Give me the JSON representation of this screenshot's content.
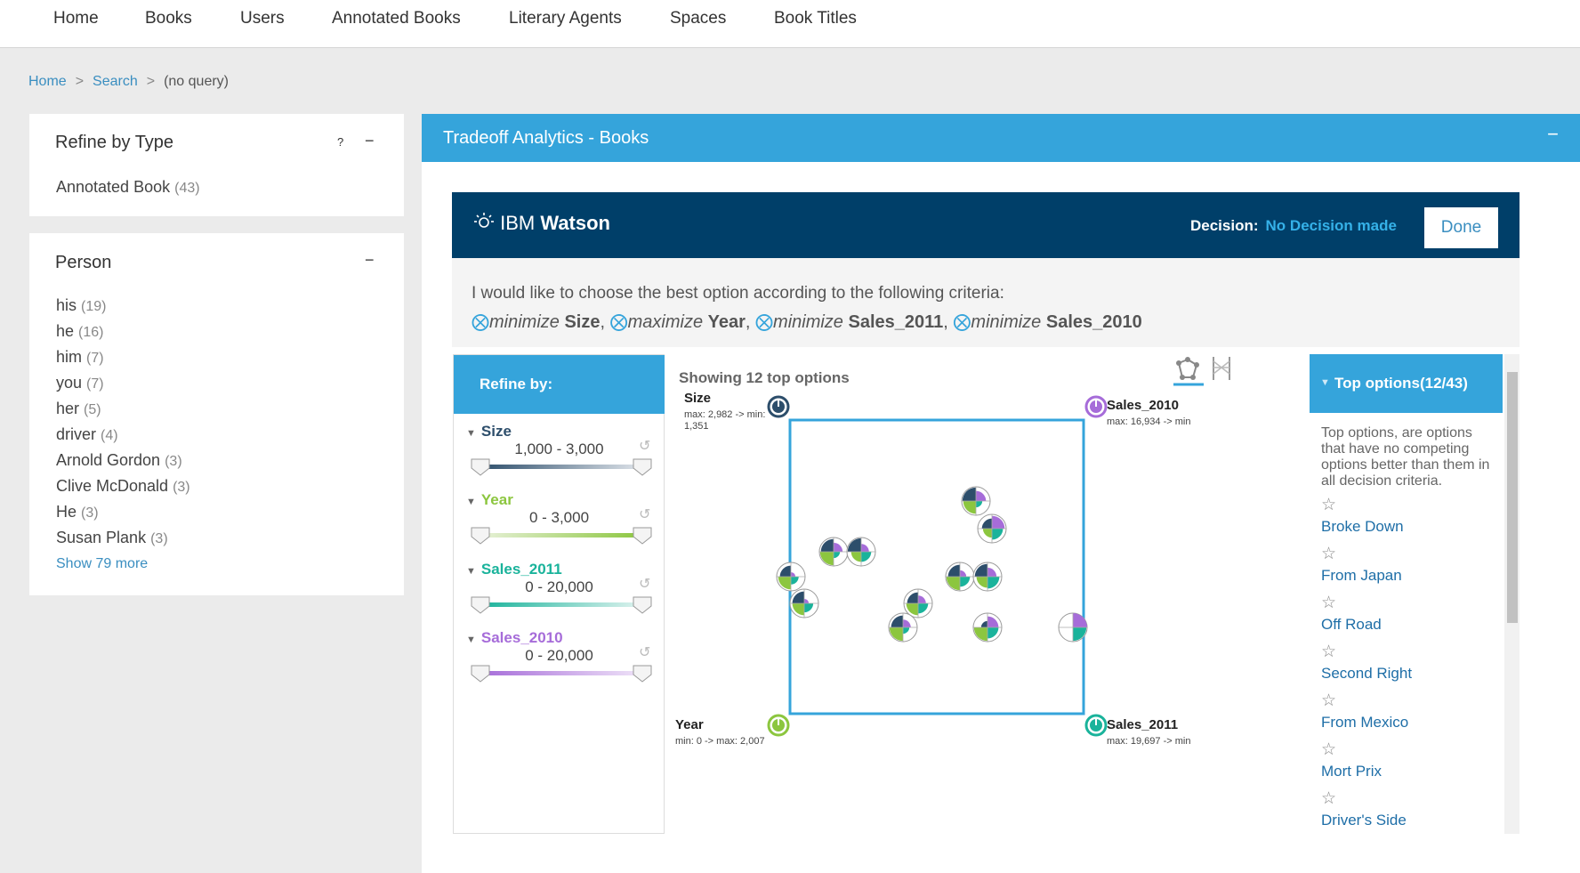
{
  "nav": [
    "Home",
    "Books",
    "Users",
    "Annotated Books",
    "Literary Agents",
    "Spaces",
    "Book Titles"
  ],
  "breadcrumb": {
    "home": "Home",
    "search": "Search",
    "current": "(no query)",
    "sep": ">"
  },
  "refine_type": {
    "title": "Refine by Type",
    "help": "?",
    "collapse": "−",
    "items": [
      {
        "label": "Annotated Book",
        "count": "(43)"
      }
    ]
  },
  "person": {
    "title": "Person",
    "collapse": "−",
    "items": [
      {
        "label": "his",
        "count": "(19)"
      },
      {
        "label": "he",
        "count": "(16)"
      },
      {
        "label": "him",
        "count": "(7)"
      },
      {
        "label": "you",
        "count": "(7)"
      },
      {
        "label": "her",
        "count": "(5)"
      },
      {
        "label": "driver",
        "count": "(4)"
      },
      {
        "label": "Arnold Gordon",
        "count": "(3)"
      },
      {
        "label": "Clive McDonald",
        "count": "(3)"
      },
      {
        "label": "He",
        "count": "(3)"
      },
      {
        "label": "Susan Plank",
        "count": "(3)"
      }
    ],
    "show_more": "Show 79 more"
  },
  "main": {
    "title": "Tradeoff Analytics - Books",
    "collapse": "−"
  },
  "watson": {
    "logo_ibm": "IBM",
    "logo_watson": "Watson",
    "decision_label": "Decision:",
    "decision_value": "No Decision made",
    "done": "Done"
  },
  "criteria": {
    "intro": "I would like to choose the best option according to the following criteria:",
    "items": [
      {
        "x": "⨂",
        "verb": "minimize",
        "name": "Size"
      },
      {
        "x": "⨂",
        "verb": "maximize",
        "name": "Year"
      },
      {
        "x": "⨂",
        "verb": "minimize",
        "name": "Sales_2011"
      },
      {
        "x": "⨂",
        "verb": "minimize",
        "name": "Sales_2010"
      }
    ]
  },
  "refine": {
    "title": "Refine by:",
    "sliders": [
      {
        "name": "Size",
        "range": "1,000 - 3,000",
        "color": "#2d4e6b"
      },
      {
        "name": "Year",
        "range": "0 - 3,000",
        "color": "#8cc63f"
      },
      {
        "name": "Sales_2011",
        "range": "0 - 20,000",
        "color": "#1ab39b"
      },
      {
        "name": "Sales_2010",
        "range": "0 - 20,000",
        "color": "#a66cd9"
      }
    ]
  },
  "chart": {
    "showing": "Showing 12 top options",
    "anchors": {
      "size": {
        "label": "Size",
        "sub1": "max: 2,982 -> min:",
        "sub2": "1,351",
        "color": "#2d4e6b"
      },
      "sales2010": {
        "label": "Sales_2010",
        "sub1": "max: 16,934 -> min",
        "color": "#a66cd9"
      },
      "year": {
        "label": "Year",
        "sub1": "min: 0 -> max: 2,007",
        "color": "#8cc63f"
      },
      "sales2011": {
        "label": "Sales_2011",
        "sub1": "max: 19,697 -> min",
        "color": "#1ab39b"
      }
    }
  },
  "top_options": {
    "title": "Top options(12/43)",
    "desc": "Top options, are options that have no competing options better than them in all decision criteria.",
    "items": [
      "Broke Down",
      "From Japan",
      "Off Road",
      "Second Right",
      "From Mexico",
      "Mort Prix",
      "Driver's Side"
    ],
    "star": "☆"
  }
}
